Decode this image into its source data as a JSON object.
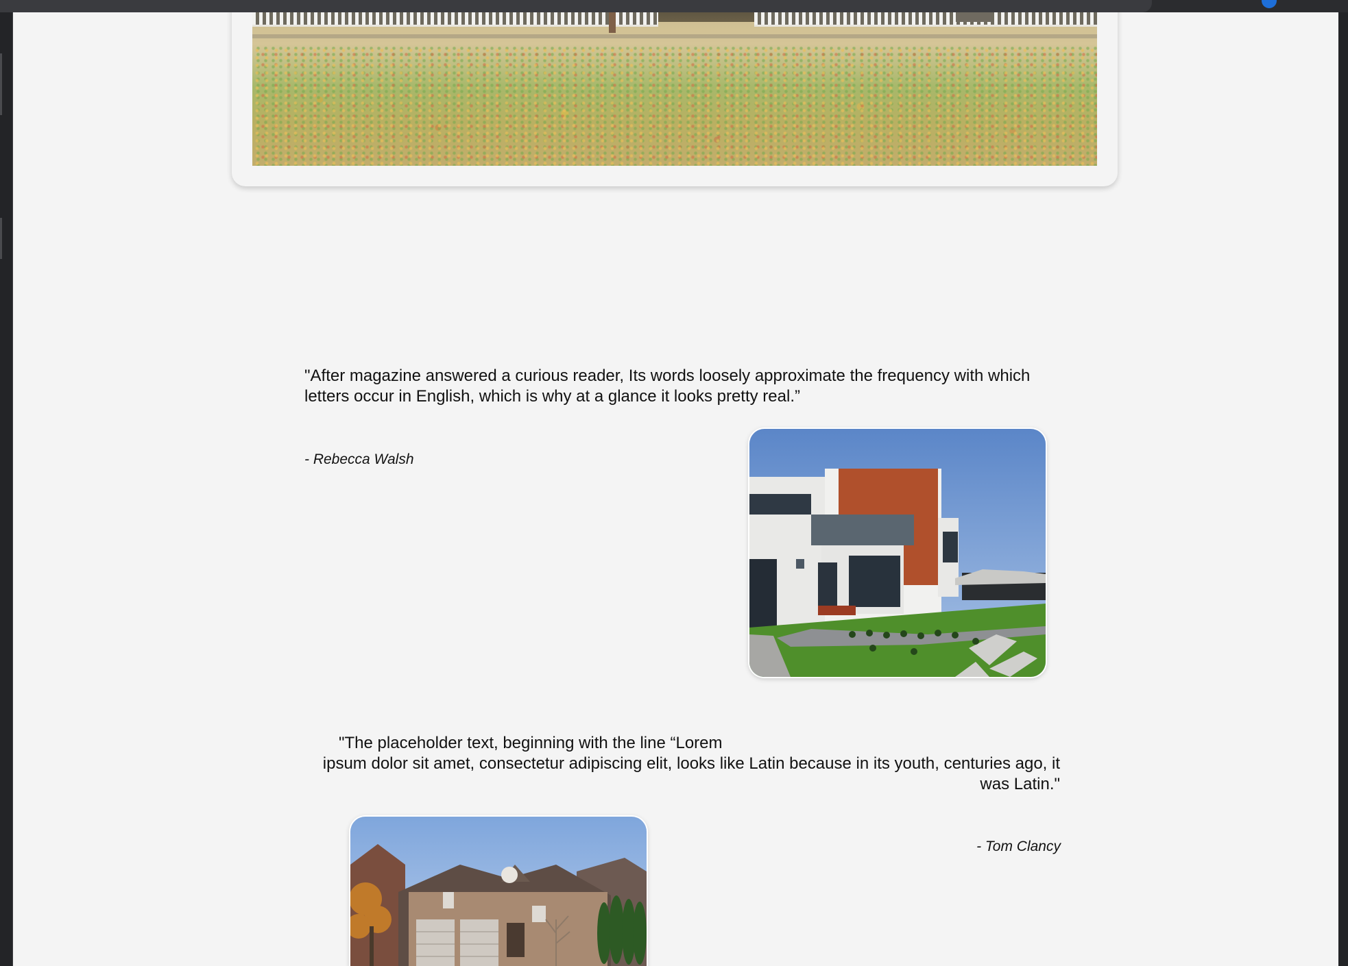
{
  "testimonials": [
    {
      "quote": "\"After magazine answered a curious reader, Its words loosely approximate the frequency with which letters occur in English, which is why at a glance it looks pretty real.”",
      "author": "- Rebecca Walsh",
      "image": "modern-house-photo"
    },
    {
      "quote_line1": "\"The placeholder text, beginning with the line “Lorem",
      "quote_line2": "ipsum dolor sit amet, consectetur adipiscing elit, looks like Latin because in its youth, centuries ago, it was Latin.\"",
      "author": "- Tom Clancy",
      "image": "brick-house-photo"
    }
  ],
  "hero": {
    "image": "autumn-lawn-photo"
  },
  "colors": {
    "page_background": "#f4f4f4",
    "window_chrome": "#1f1f21",
    "text": "#111111"
  }
}
